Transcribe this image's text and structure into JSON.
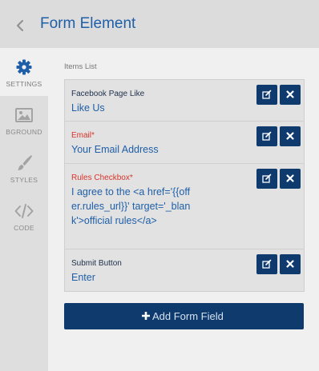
{
  "header": {
    "title": "Form Element"
  },
  "sidebar": {
    "items": [
      {
        "label": "SETTINGS",
        "icon": "gear-icon",
        "active": true
      },
      {
        "label": "BGROUND",
        "icon": "image-icon",
        "active": false
      },
      {
        "label": "STYLES",
        "icon": "brush-icon",
        "active": false
      },
      {
        "label": "CODE",
        "icon": "code-icon",
        "active": false
      }
    ]
  },
  "main": {
    "items_list_label": "Items List",
    "items": [
      {
        "label": "Facebook Page Like",
        "value": "Like Us",
        "required": false
      },
      {
        "label": "Email",
        "required_marker": "*",
        "value": "Your Email Address",
        "required": true
      },
      {
        "label": "Rules Checkbox",
        "required_marker": "*",
        "value": "I agree to the <a href='{{offer.rules_url}}' target='_blank'>official rules</a>",
        "required": true
      },
      {
        "label": "Submit Button",
        "value": "Enter",
        "required": false
      }
    ],
    "add_button_label": "Add Form Field"
  },
  "colors": {
    "accent_blue": "#1f5fa8",
    "button_navy": "#0e3a6e",
    "required_red": "#d9342b"
  }
}
